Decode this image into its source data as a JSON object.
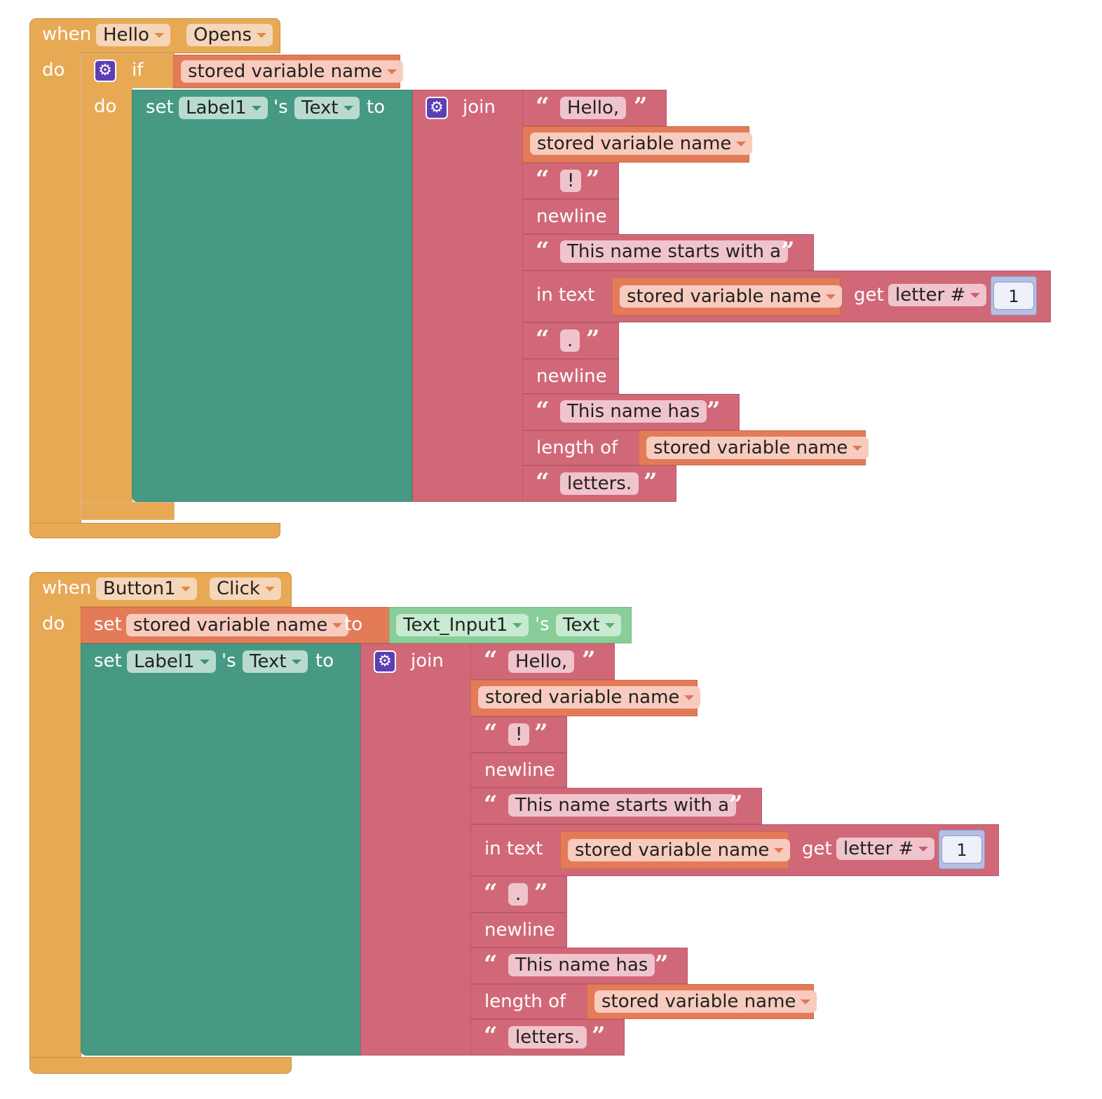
{
  "icons": {
    "mutator": "gear-icon",
    "dropdown": "chevron-down-icon"
  },
  "colors": {
    "event": "#e8a955",
    "setter": "#469a84",
    "text": "#d16878",
    "variable": "#e47b58",
    "getter": "#89ce98",
    "math": "#b4bfe2",
    "control_icon": "#5b3fb5"
  },
  "stack1": {
    "when": "when",
    "component": "Hello",
    "event": "Opens",
    "do": "do",
    "if": "if",
    "if_var": "stored variable name",
    "inner_do": "do",
    "set": "set",
    "label": "Label1",
    "possessive": "'s",
    "prop": "Text",
    "to": "to",
    "join": "join",
    "items": {
      "hello": "Hello,",
      "var1": "stored variable name",
      "excl": "!",
      "newline1": "newline",
      "starts": "This name starts with a",
      "in_text": "in text",
      "var2": "stored variable name",
      "get": "get",
      "letter": "letter #",
      "num": "1",
      "dot": ".",
      "newline2": "newline",
      "has": "This name has",
      "length_of": "length of",
      "var3": "stored variable name",
      "letters": "letters."
    }
  },
  "stack2": {
    "when": "when",
    "component": "Button1",
    "event": "Click",
    "do": "do",
    "set_var": "set",
    "var_name": "stored variable name",
    "to1": "to",
    "input": "Text_Input1",
    "possessive1": "'s",
    "input_prop": "Text",
    "set": "set",
    "label": "Label1",
    "possessive": "'s",
    "prop": "Text",
    "to": "to",
    "join": "join",
    "items": {
      "hello": "Hello,",
      "var1": "stored variable name",
      "excl": "!",
      "newline1": "newline",
      "starts": "This name starts with a",
      "in_text": "in text",
      "var2": "stored variable name",
      "get": "get",
      "letter": "letter #",
      "num": "1",
      "dot": ".",
      "newline2": "newline",
      "has": "This name has",
      "length_of": "length of",
      "var3": "stored variable name",
      "letters": "letters."
    }
  }
}
